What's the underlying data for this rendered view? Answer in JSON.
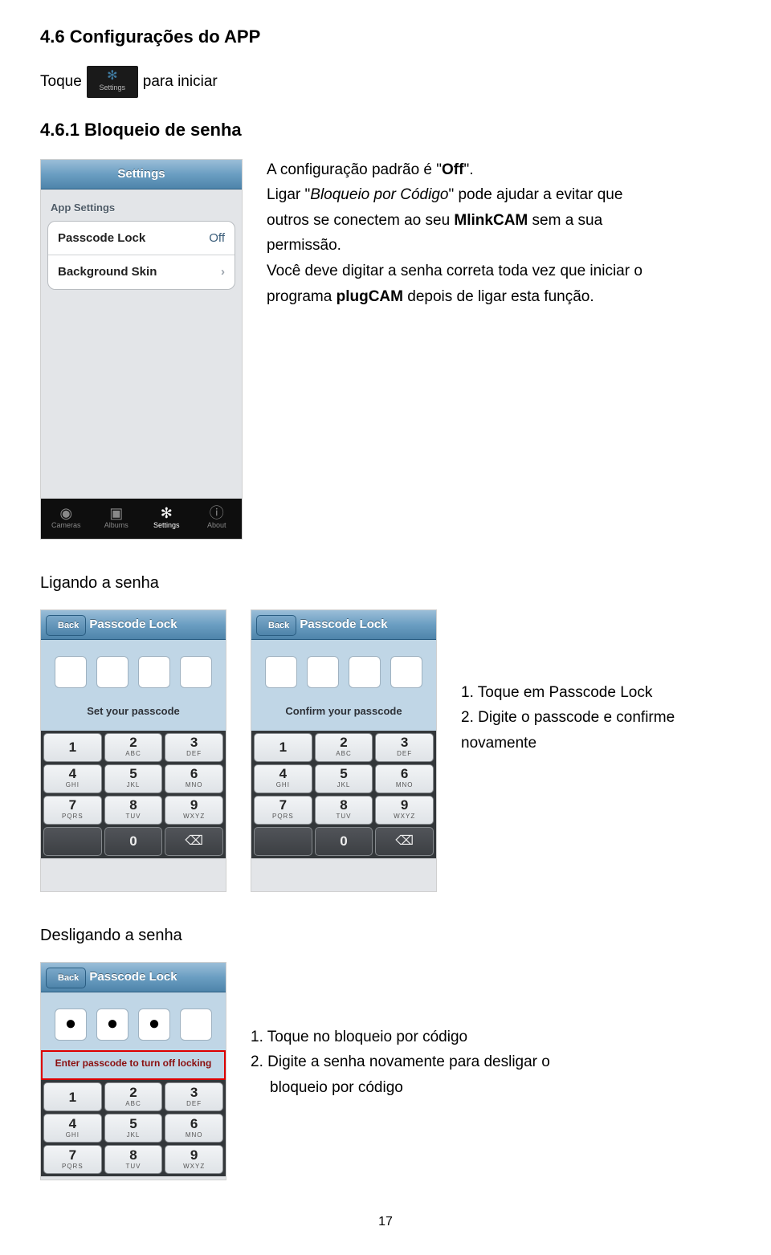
{
  "headings": {
    "h1": "4.6 Configurações do APP",
    "h2": "4.6.1 Bloqueio de senha",
    "ligando": "Ligando a senha",
    "desligando": "Desligando a senha"
  },
  "toque": {
    "before": "Toque",
    "after": "para iniciar",
    "chip_label": "Settings"
  },
  "settings_screen": {
    "title": "Settings",
    "section": "App Settings",
    "items": [
      {
        "label": "Passcode Lock",
        "value": "Off",
        "chevron": false
      },
      {
        "label": "Background Skin",
        "value": "",
        "chevron": true
      }
    ],
    "tabs": [
      "Cameras",
      "Albums",
      "Settings",
      "About"
    ]
  },
  "paragraph1": {
    "t1a": "A configuração padrão é \"",
    "t1b": "Off",
    "t1c": "\".",
    "t2a": "Ligar \"",
    "t2b": "Bloqueio por Código",
    "t2c": "\" pode ajudar a evitar que",
    "t3a": "outros se conectem ao seu ",
    "t3b": "MlinkCAM",
    "t3c": "   sem a sua",
    "t4": "permissão.",
    "t5": "Você deve digitar a senha correta toda vez que iniciar o",
    "t6a": "programa ",
    "t6b": "plugCAM",
    "t6c": " depois de ligar esta função."
  },
  "passcode": {
    "back": "Back",
    "title": "Passcode Lock",
    "set_label": "Set your passcode",
    "confirm_label": "Confirm your passcode",
    "turnoff_label": "Enter passcode to turn off locking",
    "keys": [
      {
        "n": "1",
        "l": ""
      },
      {
        "n": "2",
        "l": "ABC"
      },
      {
        "n": "3",
        "l": "DEF"
      },
      {
        "n": "4",
        "l": "GHI"
      },
      {
        "n": "5",
        "l": "JKL"
      },
      {
        "n": "6",
        "l": "MNO"
      },
      {
        "n": "7",
        "l": "PQRS"
      },
      {
        "n": "8",
        "l": "TUV"
      },
      {
        "n": "9",
        "l": "WXYZ"
      }
    ]
  },
  "steps_on": {
    "s1": "1. Toque em Passcode Lock",
    "s2": "2. Digite o passcode e confirme",
    "s3": "novamente"
  },
  "steps_off": {
    "s1": "1.  Toque no bloqueio por código",
    "s2": "2.  Digite a senha novamente para desligar o",
    "s3": "bloqueio por código"
  },
  "page_number": "17"
}
